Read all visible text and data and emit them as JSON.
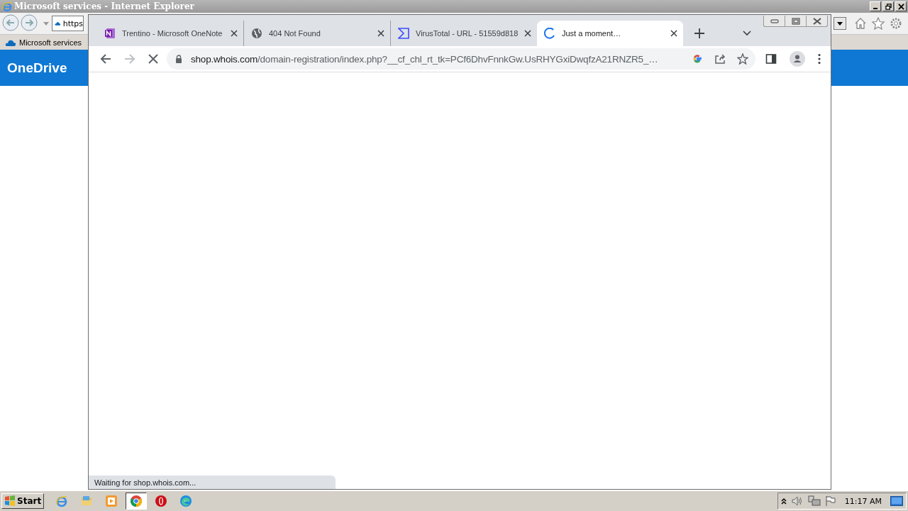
{
  "ie_window": {
    "title": "Microsoft services - Internet Explorer",
    "address": "https",
    "favorites": [
      {
        "label": "Microsoft services"
      }
    ],
    "page_header": "OneDrive"
  },
  "chrome_window": {
    "tabs": [
      {
        "title": "Trentino - Microsoft OneNote",
        "kind": "onenote",
        "selected": false
      },
      {
        "title": "404 Not Found",
        "kind": "globe",
        "selected": false
      },
      {
        "title": "VirusTotal - URL - 51559d818",
        "kind": "virustotal",
        "selected": false
      },
      {
        "title": "Just a moment…",
        "kind": "loading",
        "selected": true
      }
    ],
    "url_host": "shop.whois.com",
    "url_path": "/domain-registration/index.php?__cf_chl_rt_tk=PCf6DhvFnnkGw.UsRHYGxiDwqfzA21RNZR5_…",
    "status": "Waiting for shop.whois.com..."
  },
  "taskbar": {
    "start": "Start",
    "apps": [
      {
        "kind": "ie",
        "selected": false
      },
      {
        "kind": "explorer",
        "selected": false
      },
      {
        "kind": "media",
        "selected": false
      },
      {
        "kind": "chrome",
        "selected": true
      },
      {
        "kind": "opera",
        "selected": false
      },
      {
        "kind": "edge",
        "selected": false
      }
    ],
    "clock": "11:17 AM"
  }
}
